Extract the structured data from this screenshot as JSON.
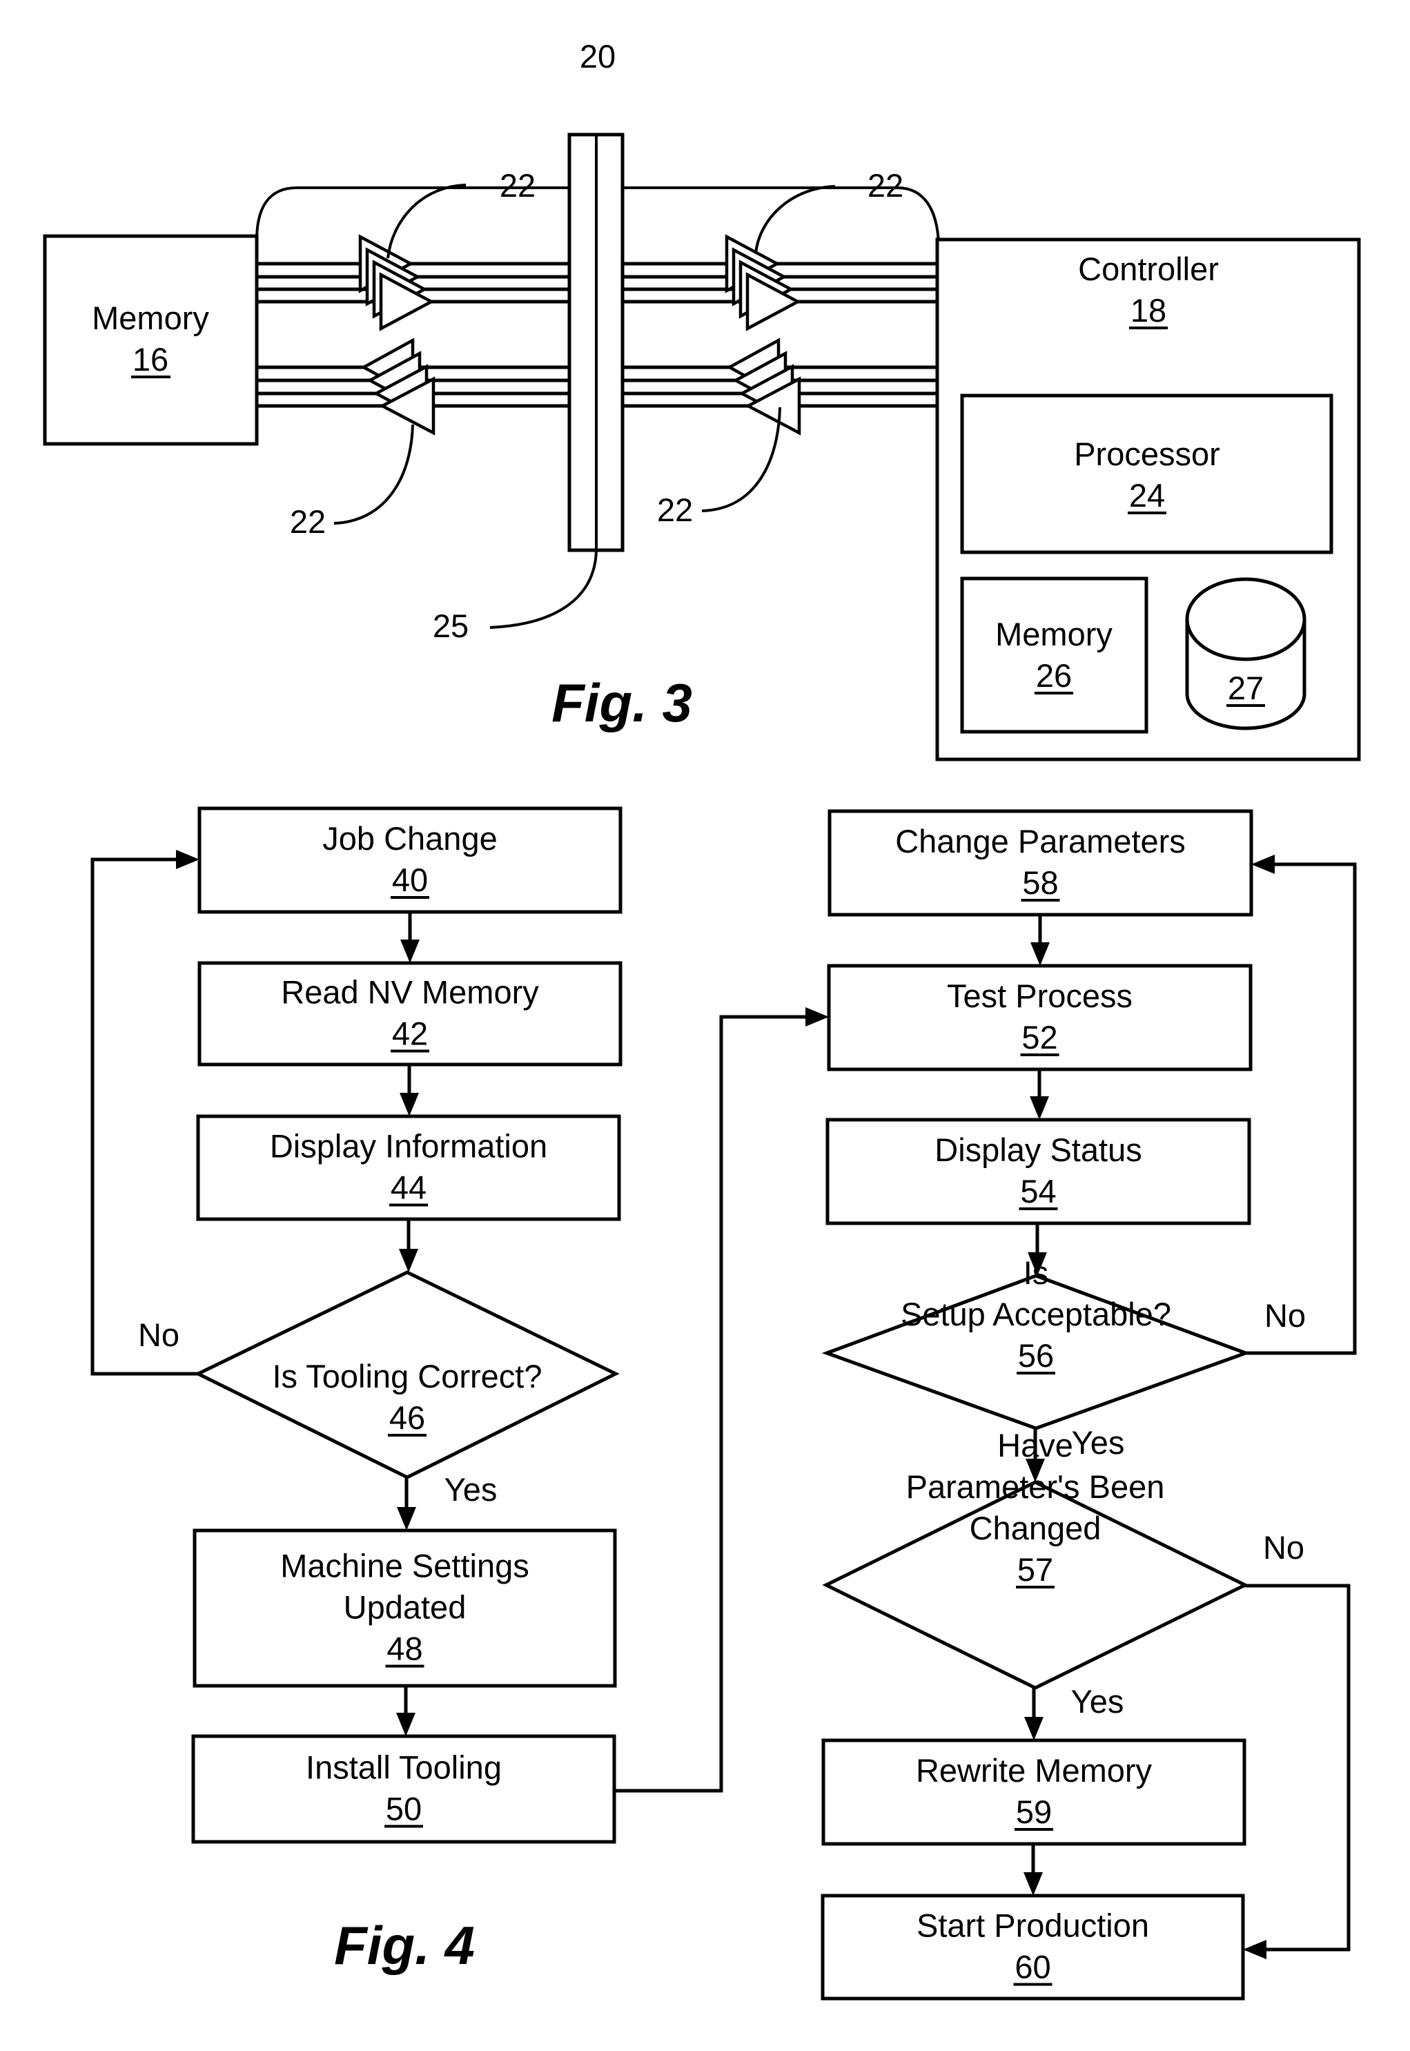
{
  "figure3": {
    "caption": "Fig. 3",
    "memory_block": {
      "label": "Memory",
      "ref": "16"
    },
    "controller_block": {
      "label": "Controller",
      "ref": "18"
    },
    "processor_block": {
      "label": "Processor",
      "ref": "24"
    },
    "controller_memory_block": {
      "label": "Memory",
      "ref": "26"
    },
    "storage_cylinder": {
      "ref": "27"
    },
    "interface_bracket_ref": "20",
    "connector_ref": "25",
    "buffer_refs": [
      "22",
      "22",
      "22",
      "22"
    ]
  },
  "figure4": {
    "caption": "Fig. 4",
    "steps": [
      {
        "id": "job-change",
        "lines": [
          "Job Change"
        ],
        "ref": "40",
        "shape": "process"
      },
      {
        "id": "read-nv-memory",
        "lines": [
          "Read NV Memory"
        ],
        "ref": "42",
        "shape": "process"
      },
      {
        "id": "display-information",
        "lines": [
          "Display Information"
        ],
        "ref": "44",
        "shape": "process"
      },
      {
        "id": "is-tooling-correct",
        "lines": [
          "Is Tooling Correct?"
        ],
        "ref": "46",
        "shape": "decision"
      },
      {
        "id": "machine-settings-updated",
        "lines": [
          "Machine Settings",
          "Updated"
        ],
        "ref": "48",
        "shape": "process"
      },
      {
        "id": "install-tooling",
        "lines": [
          "Install Tooling"
        ],
        "ref": "50",
        "shape": "process"
      },
      {
        "id": "change-parameters",
        "lines": [
          "Change Parameters"
        ],
        "ref": "58",
        "shape": "process"
      },
      {
        "id": "test-process",
        "lines": [
          "Test Process"
        ],
        "ref": "52",
        "shape": "process"
      },
      {
        "id": "display-status",
        "lines": [
          "Display Status"
        ],
        "ref": "54",
        "shape": "process"
      },
      {
        "id": "is-setup-acceptable",
        "lines": [
          "Is",
          "Setup Acceptable?"
        ],
        "ref": "56",
        "shape": "decision"
      },
      {
        "id": "have-parameters-been-changed",
        "lines": [
          "Have",
          "Parameter's Been",
          "Changed"
        ],
        "ref": "57",
        "shape": "decision"
      },
      {
        "id": "rewrite-memory",
        "lines": [
          "Rewrite Memory"
        ],
        "ref": "59",
        "shape": "process"
      },
      {
        "id": "start-production",
        "lines": [
          "Start Production"
        ],
        "ref": "60",
        "shape": "process"
      }
    ],
    "edge_labels": {
      "tooling_no": "No",
      "tooling_yes": "Yes",
      "setup_no": "No",
      "setup_yes": "Yes",
      "params_no": "No",
      "params_yes": "Yes"
    }
  }
}
